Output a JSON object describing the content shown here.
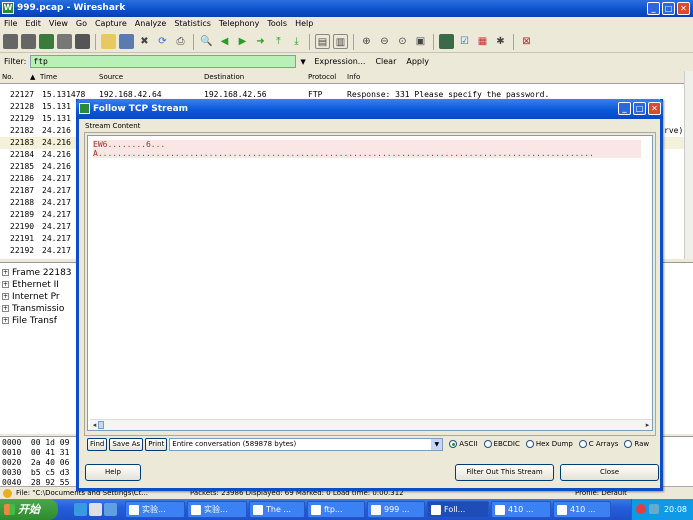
{
  "main_window": {
    "title": "999.pcap - Wireshark",
    "icon": "wireshark-icon"
  },
  "menu": [
    "File",
    "Edit",
    "View",
    "Go",
    "Capture",
    "Analyze",
    "Statistics",
    "Telephony",
    "Tools",
    "Help"
  ],
  "filter": {
    "label": "Filter:",
    "value": "ftp",
    "expression": "Expression...",
    "clear": "Clear",
    "apply": "Apply"
  },
  "columns": {
    "no": "No.",
    "time": "Time",
    "source": "Source",
    "destination": "Destination",
    "protocol": "Protocol",
    "info": "Info"
  },
  "packets": [
    {
      "no": "22127",
      "time": "15.131478",
      "src": "192.168.42.64",
      "dst": "192.168.42.56",
      "proto": "FTP",
      "info": "Response: 331 Please specify the password."
    },
    {
      "no": "22128",
      "time": "15.131",
      "src": "",
      "dst": "",
      "proto": "",
      "info": ""
    },
    {
      "no": "22129",
      "time": "15.131",
      "src": "",
      "dst": "",
      "proto": "",
      "info": ""
    },
    {
      "no": "22182",
      "time": "24.216",
      "src": "",
      "dst": "",
      "proto": "",
      "info": "rve)"
    },
    {
      "no": "22183",
      "time": "24.216",
      "src": "",
      "dst": "",
      "proto": "",
      "info": ""
    },
    {
      "no": "22184",
      "time": "24.216",
      "src": "",
      "dst": "",
      "proto": "",
      "info": ""
    },
    {
      "no": "22185",
      "time": "24.216",
      "src": "",
      "dst": "",
      "proto": "",
      "info": ""
    },
    {
      "no": "22186",
      "time": "24.217",
      "src": "",
      "dst": "",
      "proto": "",
      "info": ""
    },
    {
      "no": "22187",
      "time": "24.217",
      "src": "",
      "dst": "",
      "proto": "",
      "info": ""
    },
    {
      "no": "22188",
      "time": "24.217",
      "src": "",
      "dst": "",
      "proto": "",
      "info": ""
    },
    {
      "no": "22189",
      "time": "24.217",
      "src": "",
      "dst": "",
      "proto": "",
      "info": ""
    },
    {
      "no": "22190",
      "time": "24.217",
      "src": "",
      "dst": "",
      "proto": "",
      "info": ""
    },
    {
      "no": "22191",
      "time": "24.217",
      "src": "",
      "dst": "",
      "proto": "",
      "info": ""
    },
    {
      "no": "22192",
      "time": "24.217",
      "src": "",
      "dst": "",
      "proto": "",
      "info": ""
    }
  ],
  "details": [
    "Frame 22183",
    "Ethernet II",
    "Internet Pr",
    "Transmissio",
    "File Transf"
  ],
  "hex": [
    {
      "off": "0000",
      "bytes": "00 1d 09"
    },
    {
      "off": "0010",
      "bytes": "00 41 31"
    },
    {
      "off": "0020",
      "bytes": "2a 40 06"
    },
    {
      "off": "0030",
      "bytes": "b5 c5 d3"
    },
    {
      "off": "0040",
      "bytes": "28 92 55"
    }
  ],
  "status": {
    "file": "File: \"C:\\Documents and Settings\\Ct...",
    "packets": "Packets: 23986 Displayed: 69 Marked: 0 Load time: 0:00.312",
    "profile": "Profile: Default"
  },
  "dialog": {
    "title": "Follow TCP Stream",
    "stream_label": "Stream Content",
    "line1": "EW6........6...",
    "line2": "A.......................................................................................................",
    "find": "Find",
    "save_as": "Save As",
    "print": "Print",
    "conversation": "Entire conversation (589878 bytes)",
    "radios": [
      {
        "label": "ASCII",
        "on": true
      },
      {
        "label": "EBCDIC",
        "on": false
      },
      {
        "label": "Hex Dump",
        "on": false
      },
      {
        "label": "C Arrays",
        "on": false
      },
      {
        "label": "Raw",
        "on": false
      }
    ],
    "help": "Help",
    "filter_out": "Filter Out This Stream",
    "close": "Close"
  },
  "taskbar": {
    "start": "开始",
    "tasks": [
      "实验...",
      "实验...",
      "The ...",
      "ftp...",
      "999 ...",
      "Foll...",
      "410 ...",
      "410 ..."
    ],
    "clock": "20:08"
  }
}
